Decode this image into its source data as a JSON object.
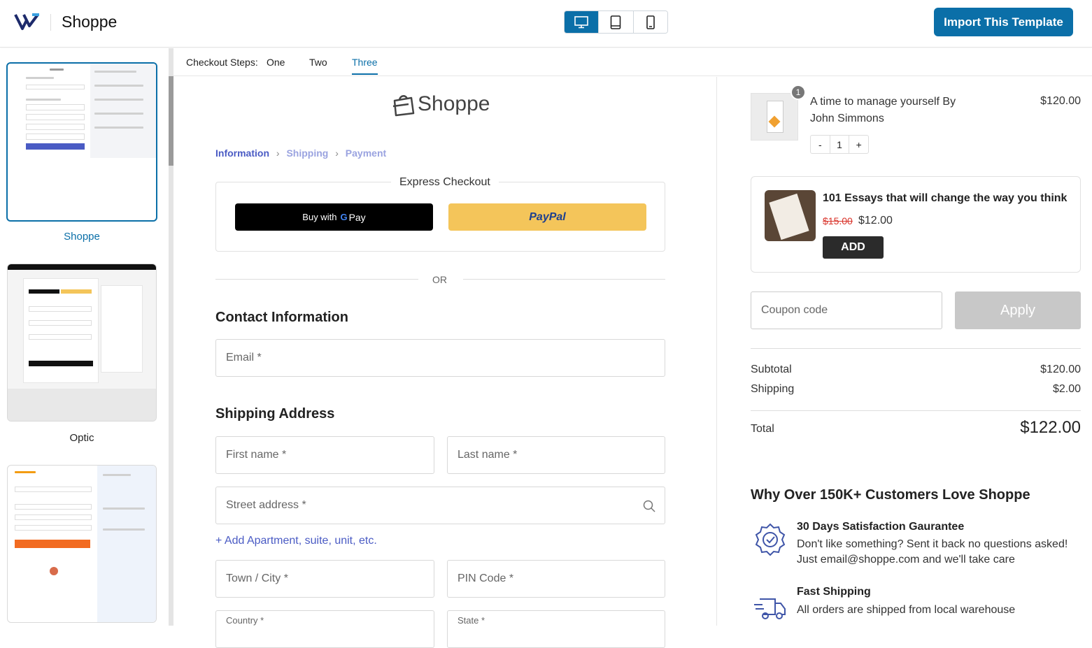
{
  "header": {
    "brand": "Shoppe",
    "import_label": "Import This Template",
    "devices": [
      "desktop-icon",
      "tablet-icon",
      "mobile-icon"
    ],
    "accent": "#0b6fa8"
  },
  "sidebar": {
    "templates": [
      {
        "label": "Shoppe",
        "selected": true
      },
      {
        "label": "Optic",
        "selected": false
      },
      {
        "label": "",
        "selected": false
      }
    ]
  },
  "steps": {
    "label": "Checkout Steps:",
    "items": [
      "One",
      "Two",
      "Three"
    ],
    "active": "Three"
  },
  "form": {
    "logo_text": "Shoppe",
    "breadcrumb": [
      "Information",
      "Shipping",
      "Payment"
    ],
    "express_title": "Express Checkout",
    "gpay_label": "Buy with",
    "gpay_brand": "Pay",
    "paypal_label": "PayPal",
    "or_text": "OR",
    "contact_heading": "Contact Information",
    "email_placeholder": "Email *",
    "shipping_heading": "Shipping Address",
    "first_name_placeholder": "First name *",
    "last_name_placeholder": "Last name *",
    "street_placeholder": "Street address *",
    "add_apartment": "Add Apartment, suite, unit, etc.",
    "city_placeholder": "Town / City *",
    "pin_placeholder": "PIN Code *",
    "country_label": "Country *",
    "state_label": "State *"
  },
  "summary": {
    "item": {
      "quantity_badge": "1",
      "name": "A time to manage yourself By John Simmons",
      "price": "$120.00",
      "qty_minus": "-",
      "qty_value": "1",
      "qty_plus": "+"
    },
    "upsell": {
      "title": "101 Essays that will change the way you think",
      "old_price": "$15.00",
      "new_price": "$12.00",
      "add_label": "ADD"
    },
    "coupon_placeholder": "Coupon code",
    "apply_label": "Apply",
    "subtotal_label": "Subtotal",
    "subtotal_value": "$120.00",
    "shipping_label": "Shipping",
    "shipping_value": "$2.00",
    "total_label": "Total",
    "total_value": "$122.00",
    "why_heading": "Why Over 150K+ Customers Love Shoppe",
    "features": [
      {
        "icon": "badge-check-icon",
        "title": "30 Days Satisfaction Gaurantee",
        "text": "Don't like something? Sent it back no questions asked! Just email@shoppe.com and we'll take care"
      },
      {
        "icon": "truck-icon",
        "title": "Fast Shipping",
        "text": "All orders are shipped from local warehouse"
      }
    ]
  }
}
